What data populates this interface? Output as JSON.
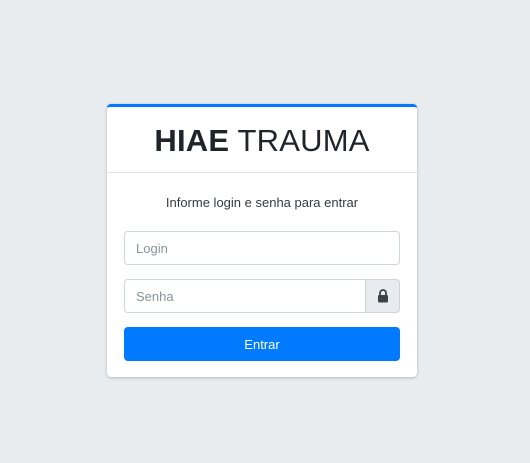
{
  "header": {
    "brand_bold": "HIAE",
    "brand_light": "TRAUMA"
  },
  "form": {
    "message": "Informe login e senha para entrar",
    "login_placeholder": "Login",
    "password_placeholder": "Senha",
    "password_addon_icon": "lock-icon",
    "submit_label": "Entrar"
  },
  "colors": {
    "accent": "#007bff",
    "background": "#e9ecef"
  }
}
